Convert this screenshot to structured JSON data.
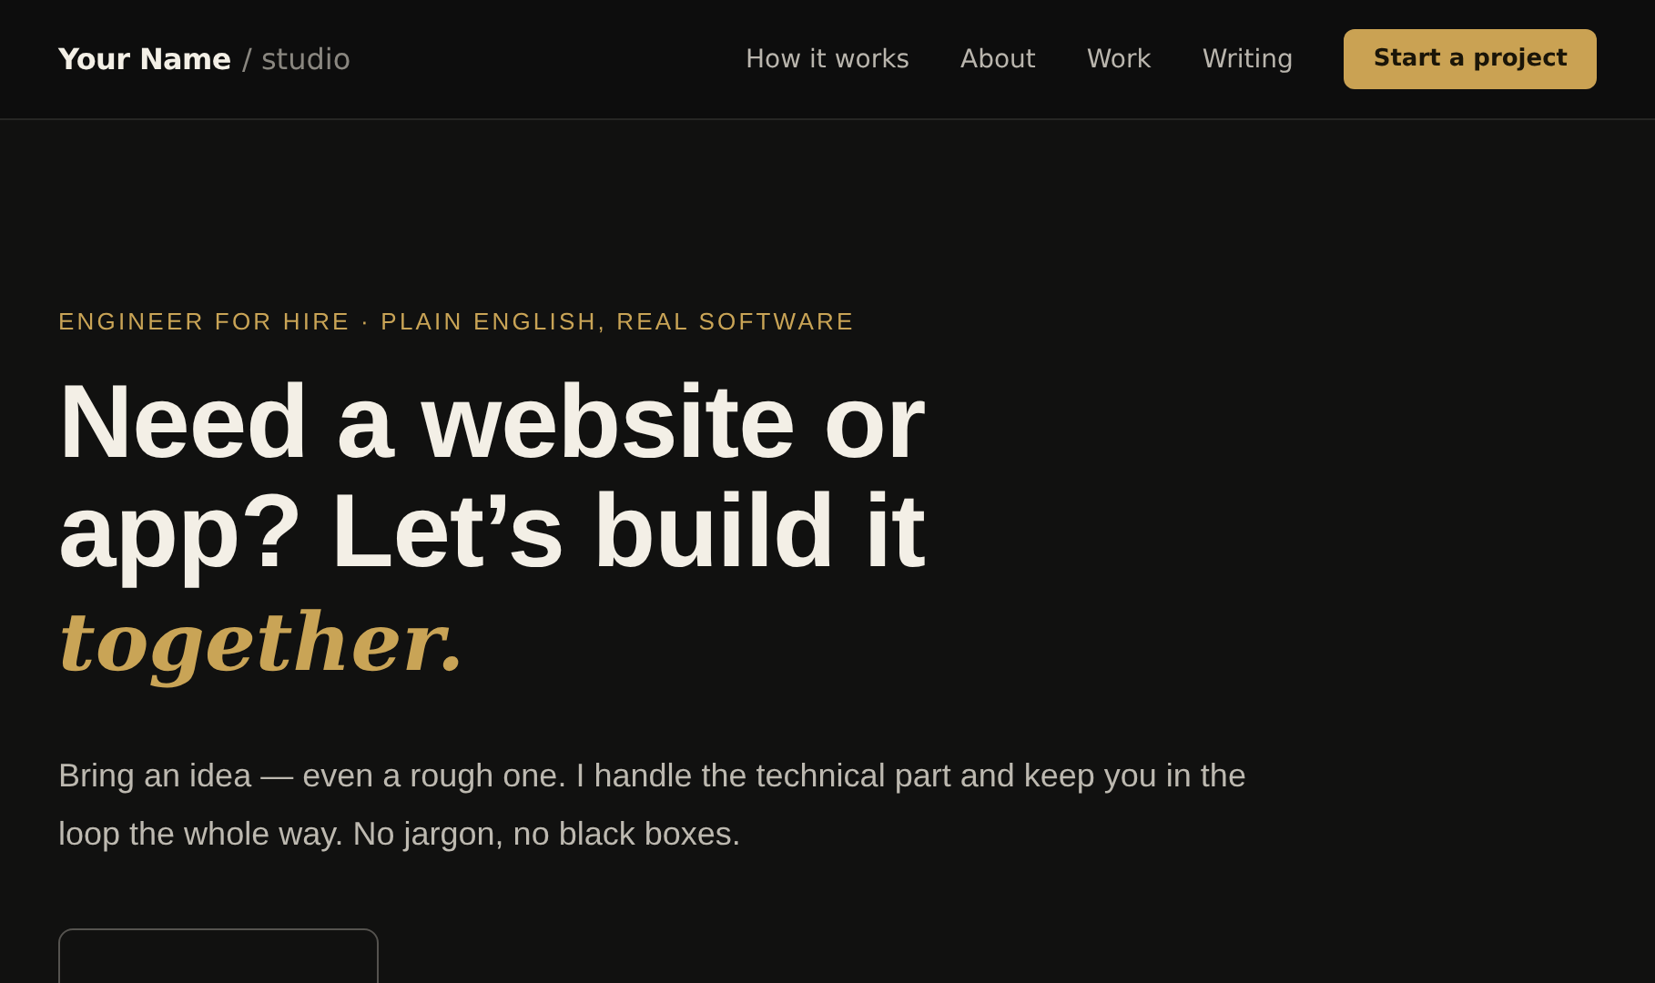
{
  "header": {
    "brand": "Your Name",
    "brand_suffix": "/ studio",
    "nav": [
      {
        "label": "How it works"
      },
      {
        "label": "About"
      },
      {
        "label": "Work"
      },
      {
        "label": "Writing"
      }
    ],
    "cta": "Start a project"
  },
  "hero": {
    "eyebrow": "ENGINEER FOR HIRE · PLAIN ENGLISH, REAL SOFTWARE",
    "headline": "Need a website or app? Let’s build it *together.*",
    "lead": "Bring an idea — even a rough one. I handle the technical part and keep you in the loop the whole way. No jargon, no black boxes."
  }
}
